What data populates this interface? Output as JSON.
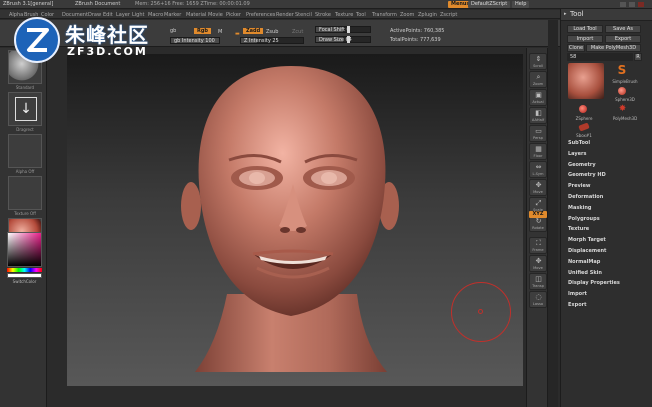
{
  "titlebar": {
    "app": "ZBrush 3.1[general]",
    "doc": "ZBrush Document",
    "stats": "Mem: 256+16  Free: 1659  ZTime: 00:00:01.09",
    "menus_button": "Menus",
    "script_button": "DefaultZScript",
    "help_button": "Help"
  },
  "menubar": {
    "items": [
      "Alpha",
      "Brush",
      "Color",
      "Document",
      "Draw",
      "Edit",
      "Layer",
      "Light",
      "Macro",
      "Marker",
      "Material",
      "Movie",
      "Picker",
      "Preferences",
      "Render",
      "Stencil",
      "Stroke",
      "Texture",
      "Tool",
      "Transform",
      "Zoom",
      "Zplugin",
      "Zscript"
    ]
  },
  "topshelf": {
    "rgb_suffix": "gb",
    "rgb_btn": "Rgb",
    "m_btn": "M",
    "rgb_intensity": "gb Intensity 100",
    "zadd_btn": "Zadd",
    "zsub_btn": "Zsub",
    "zcut_btn": "Zcut",
    "z_intensity": "Z Intensity 25",
    "focal_shift": "Focal Shift 0",
    "draw_size": "Draw Size 64",
    "active_points": "ActivePoints: 760,385",
    "total_points": "TotalPoints: 777,639",
    "focal_value": 0.5,
    "draw_value": 0.5
  },
  "leftshelf": {
    "thumbs": [
      "Standard",
      "Dragrect",
      "Alpha Off",
      "Texture Off",
      "MatCap Red"
    ],
    "switch_color": "SwitchColor"
  },
  "rightshelf": {
    "buttons": [
      {
        "icon": "scroll-icon",
        "label": "Scroll",
        "glyph": "⇕"
      },
      {
        "icon": "zoom-icon",
        "label": "Zoom",
        "glyph": "⌕"
      },
      {
        "icon": "actual-icon",
        "label": "Actual",
        "glyph": "▣"
      },
      {
        "icon": "aahalf-icon",
        "label": "AAHalf",
        "glyph": "◧"
      },
      {
        "icon": "persp-icon",
        "label": "Persp",
        "glyph": "▭"
      },
      {
        "icon": "floor-icon",
        "label": "Floor",
        "glyph": "▦"
      },
      {
        "icon": "lsym-icon",
        "label": "L.Sym",
        "glyph": "⇔"
      },
      {
        "icon": "move-icon",
        "label": "Move",
        "glyph": "✥"
      },
      {
        "icon": "scale-icon",
        "label": "Scale",
        "glyph": "⤢"
      },
      {
        "icon": "rotate-icon",
        "label": "Rotate",
        "glyph": "↻"
      }
    ],
    "xyz_btn": "XYZ",
    "lower": [
      {
        "icon": "frame-icon",
        "label": "Frame",
        "glyph": "⛶"
      },
      {
        "icon": "move2-icon",
        "label": "Move",
        "glyph": "✥"
      },
      {
        "icon": "transp-icon",
        "label": "Transp",
        "glyph": "◫"
      },
      {
        "icon": "lasso-icon",
        "label": "Lasso",
        "glyph": "◌"
      }
    ]
  },
  "palette": {
    "title": "Tool",
    "load_tool": "Load Tool",
    "save_as": "Save As",
    "import": "Import",
    "export": "Export",
    "clone": "Clone",
    "make_poly": "Make PolyMesh3D",
    "number": "58",
    "r_btn": "R",
    "tools": [
      "SimpleBrush",
      "Sphere3D",
      "ZSphere",
      "PolyMesh3D",
      "Sbox#1"
    ],
    "sections": [
      "SubTool",
      "Layers",
      "Geometry",
      "Geometry HD",
      "Preview",
      "Deformation",
      "Masking",
      "Polygroups",
      "Texture",
      "Morph Target",
      "Displacement",
      "NormalMap",
      "Unified Skin",
      "Display Properties",
      "Import",
      "Export"
    ]
  },
  "logo": {
    "chinese": "朱峰社区",
    "url": "ZF3D.COM"
  },
  "colors": {
    "accent": "#e08a2c",
    "skin": "#c47a68",
    "cursor": "#c0302b"
  }
}
